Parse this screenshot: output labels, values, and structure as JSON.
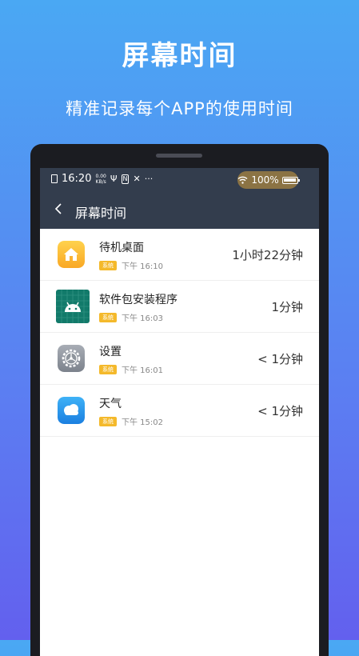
{
  "hero": {
    "title": "屏幕时间",
    "subtitle": "精准记录每个APP的使用时间"
  },
  "status_bar": {
    "time": "16:20",
    "net_speed_value": "0.00",
    "net_speed_unit": "KB/s",
    "nfc_label": "N",
    "more": "···",
    "battery_percent": "100%",
    "icons": [
      "sim-icon",
      "usb-icon",
      "nfc-icon",
      "tools-icon",
      "wifi-icon",
      "battery-icon"
    ]
  },
  "nav": {
    "title": "屏幕时间",
    "back_icon": "chevron-left-icon"
  },
  "apps": [
    {
      "name": "待机桌面",
      "tag": "系统",
      "time": "下午 16:10",
      "duration": "1小时22分钟",
      "icon": "home-icon"
    },
    {
      "name": "软件包安装程序",
      "tag": "系统",
      "time": "下午 16:03",
      "duration": "1分钟",
      "icon": "android-icon"
    },
    {
      "name": "设置",
      "tag": "系统",
      "time": "下午 16:01",
      "duration": "< 1分钟",
      "icon": "settings-gear-icon"
    },
    {
      "name": "天气",
      "tag": "系统",
      "time": "下午 15:02",
      "duration": "< 1分钟",
      "icon": "weather-cloud-icon"
    }
  ],
  "colors": {
    "gradient_top": "#4aa8f3",
    "gradient_bottom": "#6360ee",
    "header_bg": "#333d4d",
    "tag_bg": "#f4b92b",
    "battery_pill": "#8b7344"
  }
}
